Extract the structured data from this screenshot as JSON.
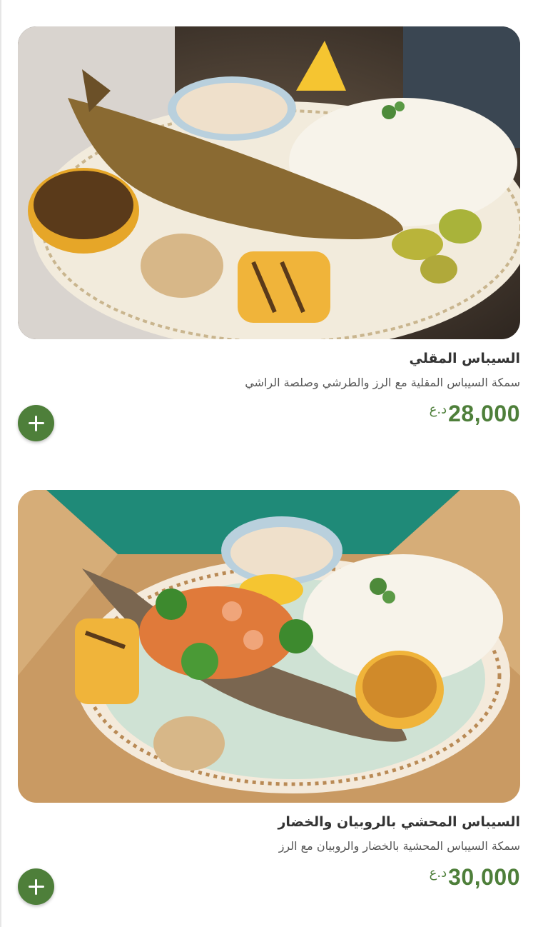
{
  "menu_items": [
    {
      "title": "السيباس المقلي",
      "description": "سمكة السيباس المقلية مع الرز والطرشي وصلصة الراشي",
      "price": "28,000",
      "currency": "د.ع",
      "image_icon": "fried-fish-plate-photo"
    },
    {
      "title": "السيباس المحشي بالروبيان والخضار",
      "description": "سمكة السيباس المحشية بالخضار والروبيان مع الرز",
      "price": "30,000",
      "currency": "د.ع",
      "image_icon": "stuffed-fish-plate-photo"
    }
  ],
  "colors": {
    "accent": "#4e7f3a",
    "title": "#333333",
    "description": "#555555"
  }
}
